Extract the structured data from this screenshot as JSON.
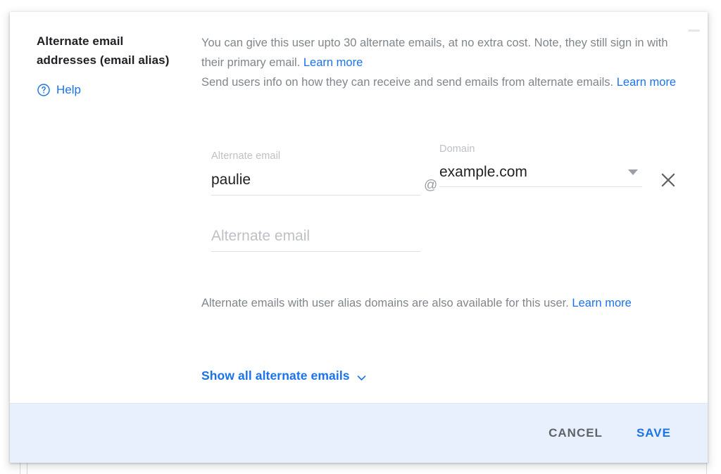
{
  "section": {
    "title": "Alternate email addresses (email alias)",
    "help_label": "Help",
    "help_icon": "help-circle-icon"
  },
  "description": {
    "paragraph1_text": "You can give this user upto 30 alternate emails, at no extra cost. Note, they still sign in with their primary email. ",
    "paragraph1_link": "Learn more",
    "paragraph2_text": "Send users info on how they can receive and send emails from alternate emails. ",
    "paragraph2_link": "Learn more"
  },
  "form": {
    "alias_label": "Alternate email",
    "alias_value": "paulie",
    "at_separator": "@",
    "domain_label": "Domain",
    "domain_value": "example.com",
    "domain_arrow_icon": "chevron-down-icon",
    "remove_icon": "close-icon",
    "empty_alias_placeholder": "Alternate email",
    "empty_alias_value": ""
  },
  "footnote": {
    "text": "Alternate emails with user alias domains are also available for this user. ",
    "link": "Learn more"
  },
  "expander": {
    "label": "Show all alternate emails",
    "icon": "chevron-down-icon"
  },
  "footer": {
    "cancel_label": "CANCEL",
    "save_label": "SAVE"
  },
  "colors": {
    "accent": "#1a73e8",
    "text_primary": "#202124",
    "text_secondary": "#80868b",
    "footer_bg": "#e8f0fe"
  }
}
